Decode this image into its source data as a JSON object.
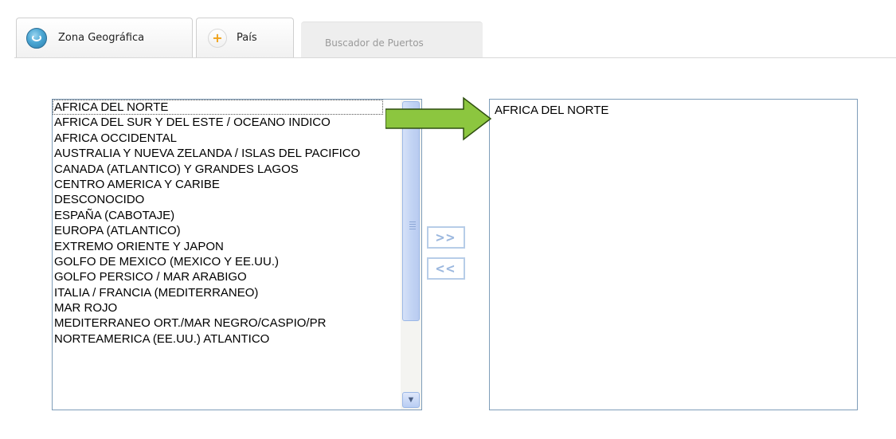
{
  "tabs": [
    {
      "label": "Zona Geográfica",
      "icon": "globe-icon"
    },
    {
      "label": "País",
      "icon": "plus-icon"
    },
    {
      "label": "Buscador de Puertos"
    }
  ],
  "available_list": {
    "items": [
      "AFRICA DEL NORTE",
      "AFRICA DEL SUR Y DEL ESTE / OCEANO INDICO",
      "AFRICA OCCIDENTAL",
      "AUSTRALIA Y NUEVA ZELANDA / ISLAS DEL PACIFICO",
      "CANADA (ATLANTICO) Y GRANDES LAGOS",
      "CENTRO AMERICA Y CARIBE",
      "DESCONOCIDO",
      "ESPAÑA (CABOTAJE)",
      "EUROPA (ATLANTICO)",
      "EXTREMO ORIENTE Y JAPON",
      "GOLFO DE MEXICO (MEXICO Y EE.UU.)",
      "GOLFO PERSICO / MAR ARABIGO",
      "ITALIA / FRANCIA (MEDITERRANEO)",
      "MAR ROJO",
      "MEDITERRANEO ORT./MAR NEGRO/CASPIO/PR",
      "NORTEAMERICA (EE.UU.) ATLANTICO"
    ],
    "focused_index": 0
  },
  "buttons": {
    "add": ">>",
    "remove": "<<"
  },
  "selected_list": {
    "items": [
      "AFRICA DEL NORTE"
    ]
  },
  "colors": {
    "arrow": "#8cc63f",
    "arrow_border": "#2f4f10",
    "list_border": "#7f9db9"
  }
}
